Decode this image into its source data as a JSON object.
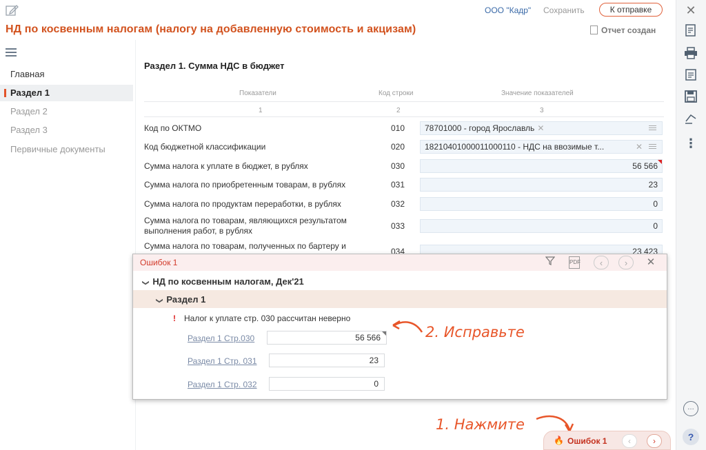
{
  "header": {
    "org": "ООО \"Кадр\"",
    "save_label": "Сохранить",
    "send_label": "К отправке",
    "page_title": "НД по косвенным налогам (налогу на добавленную стоимость и акцизам)",
    "report_status": "Отчет создан"
  },
  "nav": {
    "items": [
      {
        "label": "Главная"
      },
      {
        "label": "Раздел 1"
      },
      {
        "label": "Раздел 2"
      },
      {
        "label": "Раздел 3"
      },
      {
        "label": "Первичные документы"
      }
    ]
  },
  "section": {
    "title": "Раздел 1. Сумма НДС в бюджет",
    "col_headers": [
      "Показатели",
      "Код строки",
      "Значение показателей"
    ],
    "col_numbers": [
      "1",
      "2",
      "3"
    ],
    "rows": [
      {
        "label": "Код по ОКТМО",
        "code": "010",
        "value": "78701000 - город Ярославль"
      },
      {
        "label": "Код бюджетной классификации",
        "code": "020",
        "value": "18210401000011000110 - НДС на ввозимые т..."
      },
      {
        "label": "Сумма налога к уплате в бюджет, в рублях",
        "code": "030",
        "value": "56 566"
      },
      {
        "label": "Сумма налога по приобретенным товарам, в рублях",
        "code": "031",
        "value": "23"
      },
      {
        "label": "Сумма налога по продуктам переработки, в рублях",
        "code": "032",
        "value": "0"
      },
      {
        "label": "Сумма налога по товарам, являющихся результатом выполнения работ, в рублях",
        "code": "033",
        "value": "0"
      },
      {
        "label": "Сумма налога по товарам, полученных по бартеру и",
        "code": "034",
        "value": "23 423"
      }
    ]
  },
  "errors": {
    "count_label": "Ошибок 1",
    "group_title": "НД по косвенным налогам, Дек'21",
    "subgroup_title": "Раздел 1",
    "message": "Налог к уплате стр. 030 рассчитан неверно",
    "links": [
      {
        "label": "Раздел 1 Стр.030",
        "value": "56 566"
      },
      {
        "label": "Раздел 1 Стр. 031",
        "value": "23"
      },
      {
        "label": "Раздел 1 Стр. 032",
        "value": "0"
      }
    ]
  },
  "annotations": {
    "fix": "2. Исправьте",
    "click": "1. Нажмите"
  },
  "chip": {
    "label": "Ошибок 1"
  },
  "colors": {
    "accent": "#e2532a",
    "error": "#d23a2a",
    "link": "#3a6aa8"
  }
}
